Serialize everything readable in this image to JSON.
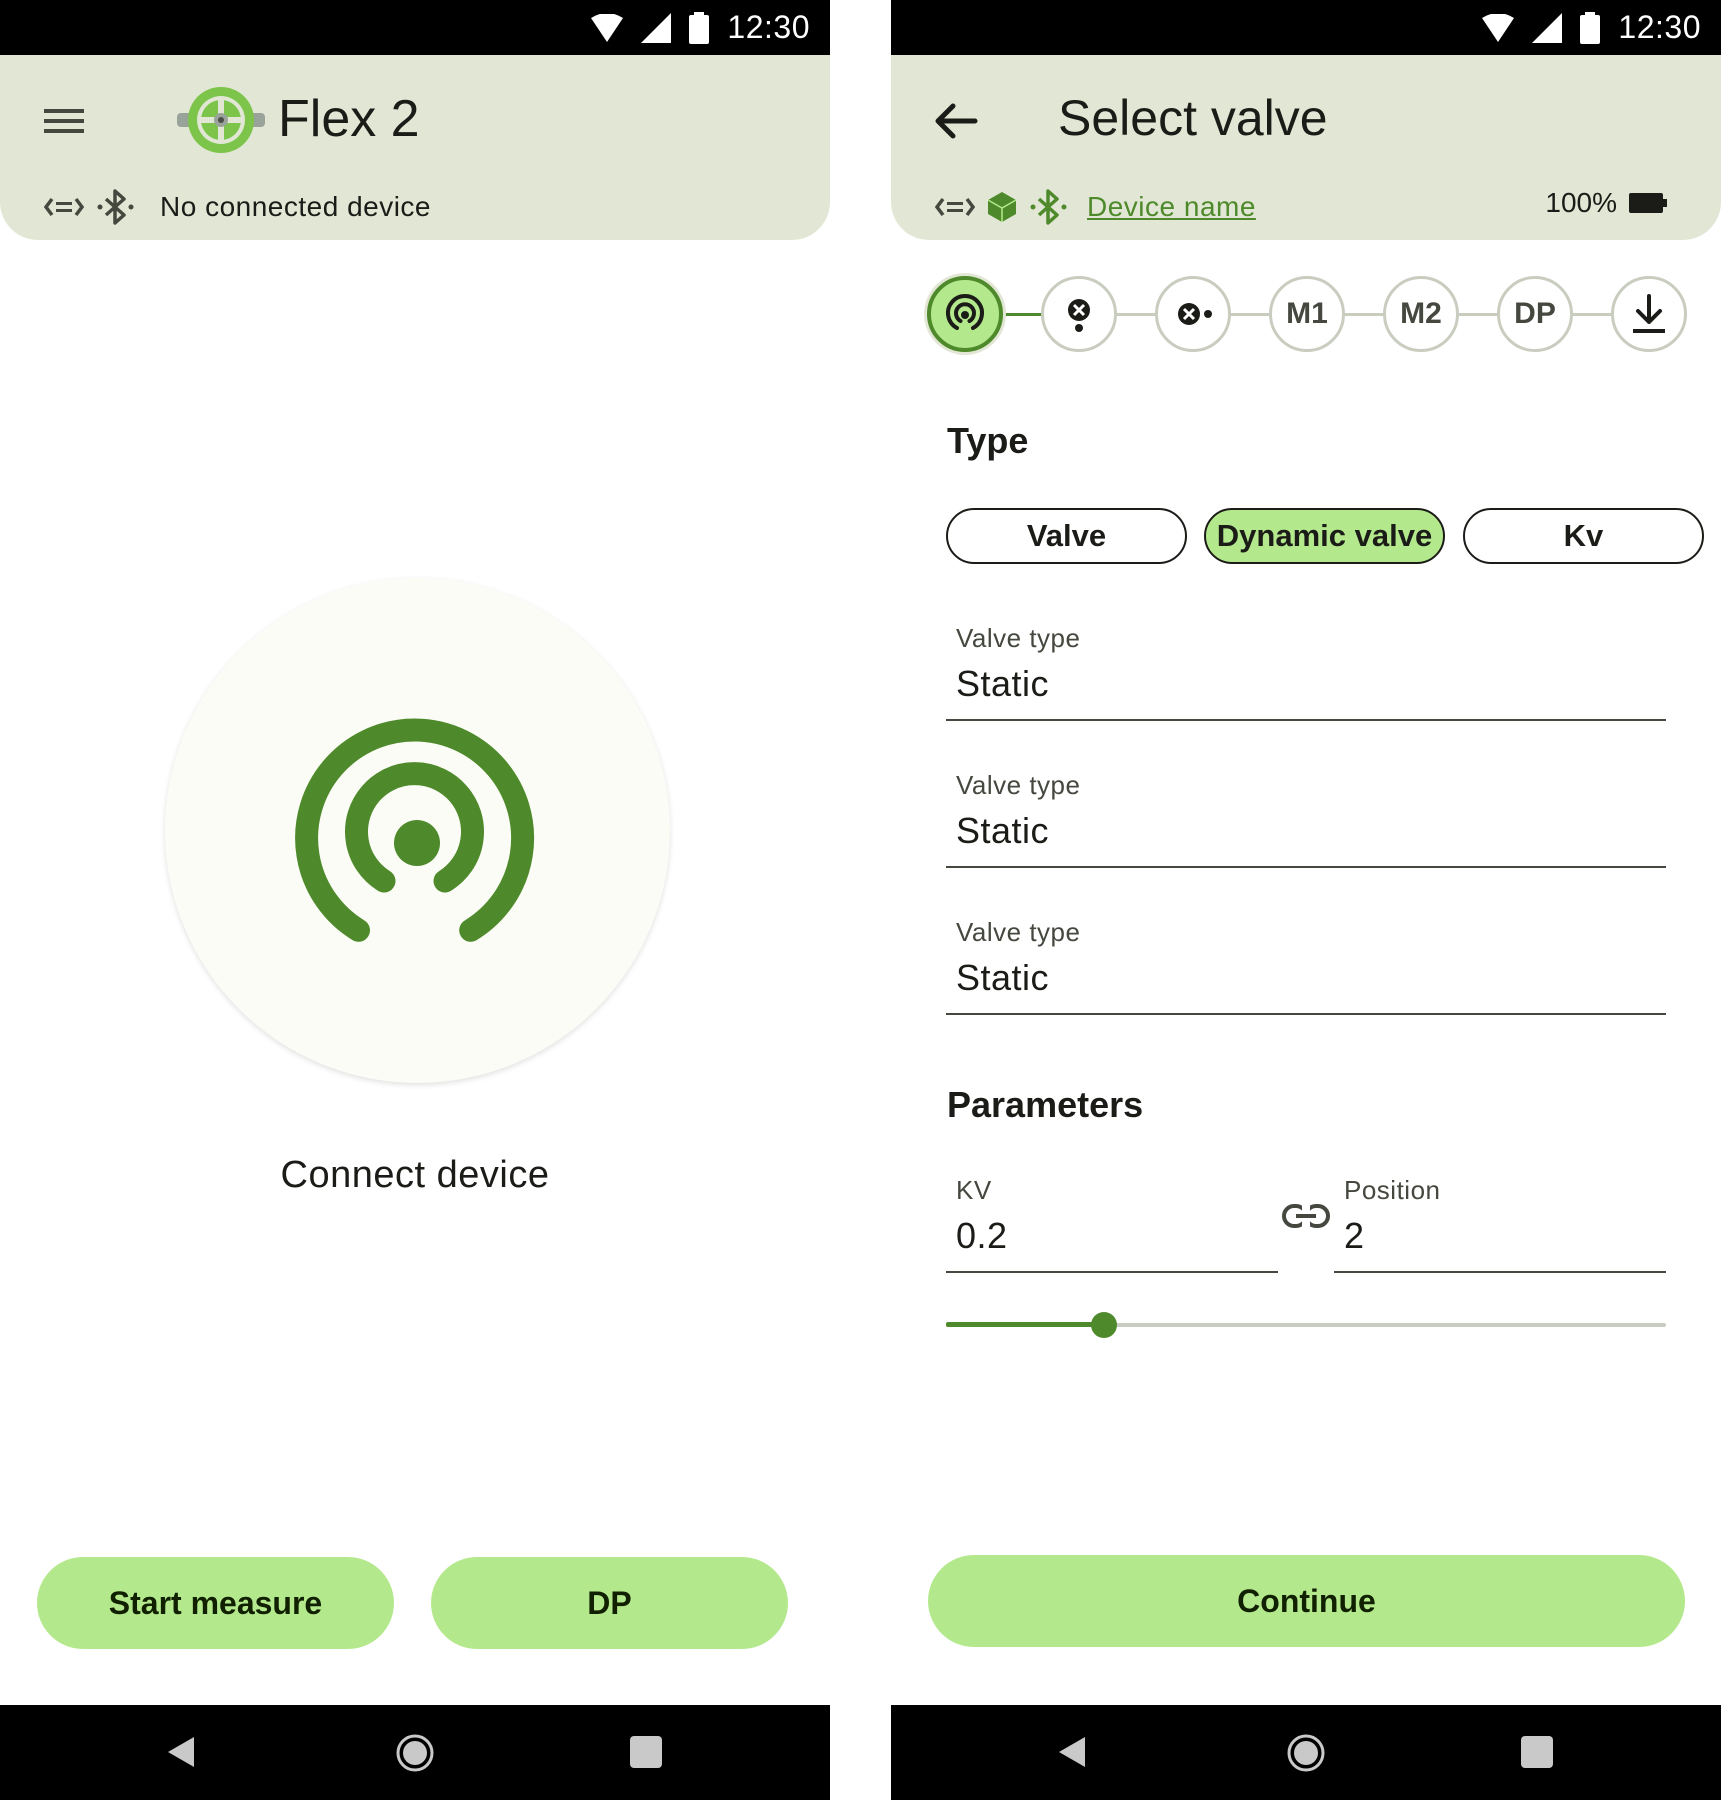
{
  "left": {
    "status": {
      "time": "12:30"
    },
    "appbar": {
      "title": "Flex 2",
      "connection_status": "No connected device"
    },
    "main": {
      "connect_label": "Connect device"
    },
    "buttons": {
      "start_measure": "Start measure",
      "dp": "DP"
    }
  },
  "right": {
    "status": {
      "time": "12:30"
    },
    "appbar": {
      "title": "Select valve",
      "device_name": "Device name",
      "battery": "100%"
    },
    "stepper": {
      "active_index": 0,
      "steps": [
        {
          "label": "",
          "icon": "sensor-icon"
        },
        {
          "label": "",
          "icon": "valve-close-icon"
        },
        {
          "label": "",
          "icon": "valve-point-icon"
        },
        {
          "label": "M1",
          "icon": ""
        },
        {
          "label": "M2",
          "icon": ""
        },
        {
          "label": "DP",
          "icon": ""
        },
        {
          "label": "",
          "icon": "download-icon"
        }
      ]
    },
    "type_section": {
      "title": "Type",
      "options": [
        "Valve",
        "Dynamic valve",
        "Kv"
      ],
      "selected": "Dynamic valve"
    },
    "fields": [
      {
        "label": "Valve type",
        "value": "Static"
      },
      {
        "label": "Valve type",
        "value": "Static"
      },
      {
        "label": "Valve type",
        "value": "Static"
      }
    ],
    "parameters": {
      "title": "Parameters",
      "kv_label": "KV",
      "kv_value": "0.2",
      "position_label": "Position",
      "position_value": "2",
      "slider_fraction": 0.22
    },
    "continue_label": "Continue"
  },
  "colors": {
    "primary": "#4e8a2b",
    "primary_container": "#b3e98c",
    "appbar_bg": "#e1e7d4",
    "surface": "#fbfcf5",
    "outline": "#c9cdc0"
  }
}
